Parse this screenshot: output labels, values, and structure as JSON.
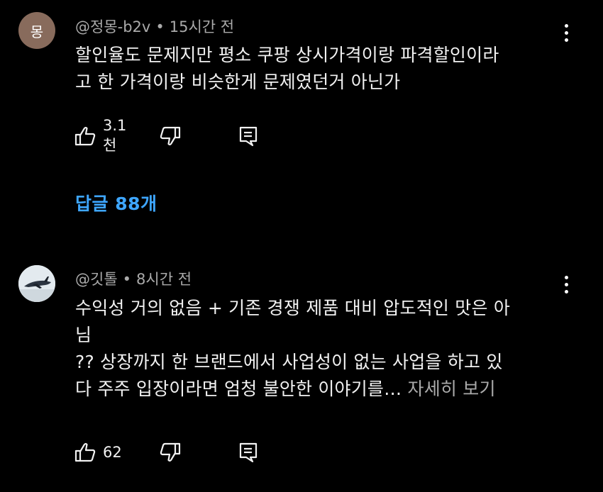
{
  "comments": [
    {
      "avatar_text": "몽",
      "author": "@정몽-b2v",
      "time": "15시간 전",
      "lines": [
        "할인율도 문제지만 평소  쿠팡 상시가격이랑 파격할인이라",
        "고 한 가격이랑 비슷한게 문제였던거 아닌가"
      ],
      "likes": "3.1천",
      "replies_label": "답글 88개"
    },
    {
      "author": "@깃톨",
      "time": "8시간 전",
      "lines": [
        "수익성 거의 없음 + 기존 경쟁 제품 대비 압도적인 맛은 아",
        "님",
        "?? 상장까지 한 브랜드에서 사업성이 없는 사업을 하고 있",
        "다 주주 입장이라면 엄청 불안한 이야기를…"
      ],
      "read_more": " 자세히 보기",
      "likes": "62"
    }
  ],
  "meta_separator": "•",
  "icons": {
    "like": "thumbs-up-icon",
    "dislike": "thumbs-down-icon",
    "reply": "reply-icon",
    "more": "more-vertical-icon",
    "avatar_image": "airplane-avatar-icon"
  },
  "colors": {
    "background": "#000000",
    "text": "#f1f1f1",
    "secondary": "#aaaaaa",
    "link": "#3ea6ff"
  }
}
